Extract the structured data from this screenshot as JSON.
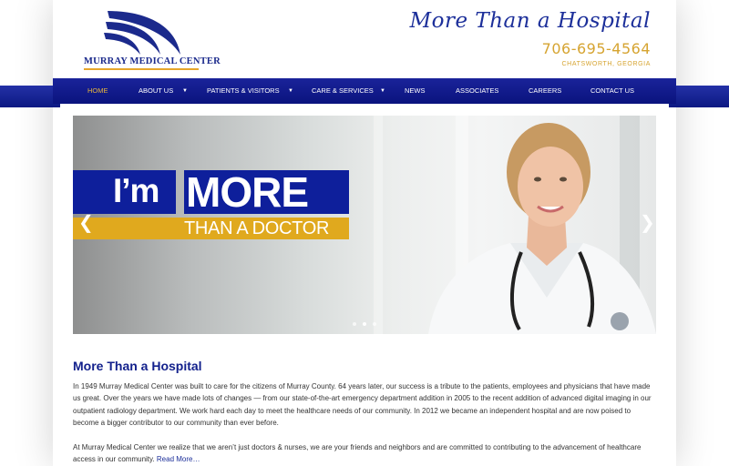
{
  "header": {
    "logo_text": "MURRAY MEDICAL CENTER",
    "tagline": "More Than a Hospital",
    "phone": "706-695-4564",
    "location": "CHATSWORTH, GEORGIA"
  },
  "nav": {
    "items": [
      {
        "label": "HOME",
        "active": true
      },
      {
        "label": "ABOUT US",
        "dropdown": true
      },
      {
        "label": "PATIENTS & VISITORS",
        "dropdown": true
      },
      {
        "label": "CARE & SERVICES",
        "dropdown": true
      },
      {
        "label": "NEWS"
      },
      {
        "label": "ASSOCIATES"
      },
      {
        "label": "CAREERS"
      },
      {
        "label": "CONTACT US"
      }
    ]
  },
  "slider": {
    "line1_a": "I’m",
    "line1_b": "MORE",
    "line2": "THAN A DOCTOR",
    "prev_icon": "chevron-left-icon",
    "next_icon": "chevron-right-icon",
    "slide_count": 3,
    "active_slide": 2
  },
  "main": {
    "heading": "More Than a Hospital",
    "para1": "In 1949 Murray Medical Center was built to care for the citizens of Murray County. 64 years later, our success is a tribute to the patients, employees and physicians that have made us great. Over the years we have made lots of changes — from our state-of-the-art emergency department addition in 2005 to the recent addition of advanced digital imaging in our outpatient radiology department. We work hard each day to meet the healthcare needs of our community. In 2012 we became an independent hospital and are now poised to become a bigger contributor to our community than ever before.",
    "para2": "At Murray Medical Center we realize that we aren’t just doctors & nurses, we are your friends and neighbors and are committed to contributing to the advancement of healthcare access in our community.",
    "read_more": "Read More…"
  },
  "colors": {
    "brand_blue": "#0e1f9b",
    "brand_gold": "#e0a91e"
  }
}
